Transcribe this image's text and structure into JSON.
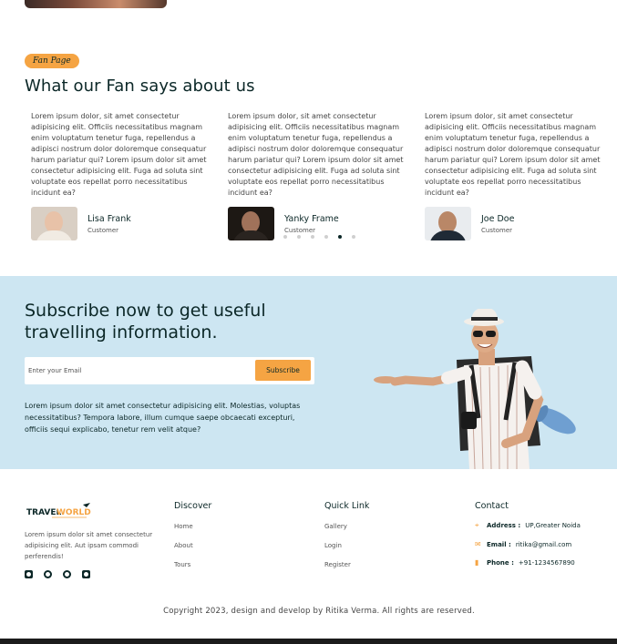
{
  "testimonials": {
    "tag": "Fan Page",
    "title": "What our Fan says about us",
    "items": [
      {
        "text": "Lorem ipsum dolor, sit amet consectetur adipisicing elit. Officiis necessitatibus magnam enim voluptatum tenetur fuga, repellendus a adipisci nostrum dolor doloremque consequatur harum pariatur qui? Lorem ipsum dolor sit amet consectetur adipisicing elit. Fuga ad soluta sint voluptate eos repellat porro necessitatibus incidunt ea?",
        "name": "Lisa Frank",
        "role": "Customer"
      },
      {
        "text": "Lorem ipsum dolor, sit amet consectetur adipisicing elit. Officiis necessitatibus magnam enim voluptatum tenetur fuga, repellendus a adipisci nostrum dolor doloremque consequatur harum pariatur qui? Lorem ipsum dolor sit amet consectetur adipisicing elit. Fuga ad soluta sint voluptate eos repellat porro necessitatibus incidunt ea?",
        "name": "Yanky Frame",
        "role": "Customer"
      },
      {
        "text": "Lorem ipsum dolor, sit amet consectetur adipisicing elit. Officiis necessitatibus magnam enim voluptatum tenetur fuga, repellendus a adipisci nostrum dolor doloremque consequatur harum pariatur qui? Lorem ipsum dolor sit amet consectetur adipisicing elit. Fuga ad soluta sint voluptate eos repellat porro necessitatibus incidunt ea?",
        "name": "Joe Doe",
        "role": "Customer"
      }
    ],
    "carousel_active_index": 4,
    "carousel_count": 6
  },
  "subscribe": {
    "title": "Subscribe now to get useful travelling information.",
    "email_placeholder": "Enter your Email",
    "button_label": "Subscribe",
    "text": "Lorem ipsum dolor sit amet consectetur adipisicing elit. Molestias, voluptas necessitatibus? Tempora labore, illum cumque saepe obcaecati excepturi, officiis sequi explicabo, tenetur rem velit atque?"
  },
  "footer": {
    "logo_text": "TRAVELWORLD",
    "description": "Lorem ipsum dolor sit amet consectetur adipisicing elit. Aut ipsam commodi perferendis!",
    "socials": [
      "youtube-icon",
      "github-icon",
      "facebook-icon",
      "instagram-icon"
    ],
    "discover": {
      "title": "Discover",
      "links": [
        "Home",
        "About",
        "Tours"
      ]
    },
    "quick_link": {
      "title": "Quick Link",
      "links": [
        "Gallery",
        "Login",
        "Register"
      ]
    },
    "contact": {
      "title": "Contact",
      "address_label": "Address :",
      "address": "UP,Greater Noida",
      "email_label": "Email :",
      "email": "ritika@gmail.com",
      "phone_label": "Phone :",
      "phone": "+91-1234567890"
    },
    "copyright": "Copyright 2023, design and develop by Ritika Verma. All rights are reserved."
  },
  "colors": {
    "accent": "#f5a443",
    "heading": "#0b2727",
    "subscribe_bg": "#cde6f2"
  }
}
